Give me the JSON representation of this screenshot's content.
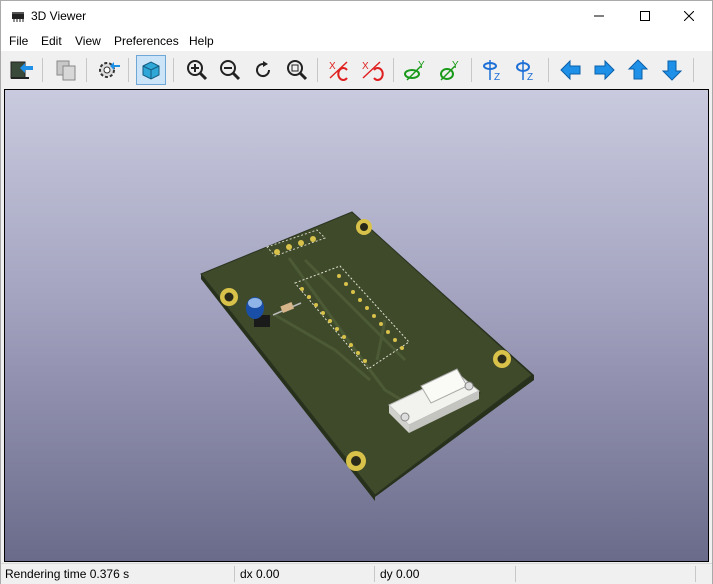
{
  "window": {
    "title": "3D Viewer",
    "controls": [
      "minimize",
      "maximize",
      "close"
    ]
  },
  "menubar": {
    "items": [
      "File",
      "Edit",
      "View",
      "Preferences",
      "Help"
    ]
  },
  "toolbar": {
    "buttons": [
      "reload-board",
      "copy-image",
      "settings",
      "raytracing-toggle",
      "zoom-in",
      "zoom-out",
      "redraw",
      "zoom-fit",
      "rotate-x-cw",
      "rotate-x-ccw",
      "rotate-y-cw",
      "rotate-y-ccw",
      "rotate-z-cw",
      "rotate-z-ccw",
      "move-left",
      "move-right",
      "move-up",
      "move-down"
    ],
    "colors": {
      "arrow_blue": "#1e90e8",
      "rotate_red": "#e02020",
      "rotate_green": "#1a9a1a",
      "rotate_blue": "#1e6fd6",
      "active_bg": "#cce4f7"
    }
  },
  "viewport": {
    "scene": "3D PCB render",
    "background_top": "#c9cade",
    "background_bottom": "#6a6a8a",
    "board_color": "#3f4a2a",
    "pad_color": "#d8c24a"
  },
  "statusbar": {
    "rendering_time": "Rendering time 0.376 s",
    "dx": "dx 0.00",
    "dy": "dy 0.00"
  }
}
